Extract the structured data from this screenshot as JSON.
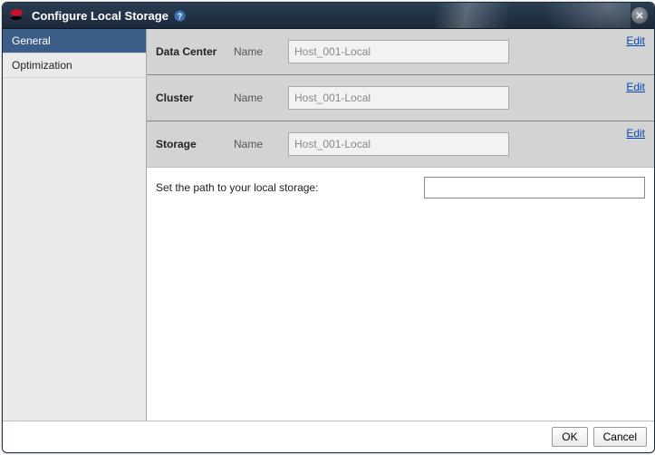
{
  "title": "Configure Local Storage",
  "sidebar": {
    "items": [
      {
        "label": "General",
        "selected": true
      },
      {
        "label": "Optimization",
        "selected": false
      }
    ]
  },
  "rows": [
    {
      "label": "Data Center",
      "field": "Name",
      "value": "Host_001-Local",
      "edit": "Edit"
    },
    {
      "label": "Cluster",
      "field": "Name",
      "value": "Host_001-Local",
      "edit": "Edit"
    },
    {
      "label": "Storage",
      "field": "Name",
      "value": "Host_001-Local",
      "edit": "Edit"
    }
  ],
  "path": {
    "label": "Set the path to your local storage:",
    "value": ""
  },
  "buttons": {
    "ok": "OK",
    "cancel": "Cancel"
  },
  "colors": {
    "accent": "#3b5e88",
    "link": "#0645ad"
  }
}
